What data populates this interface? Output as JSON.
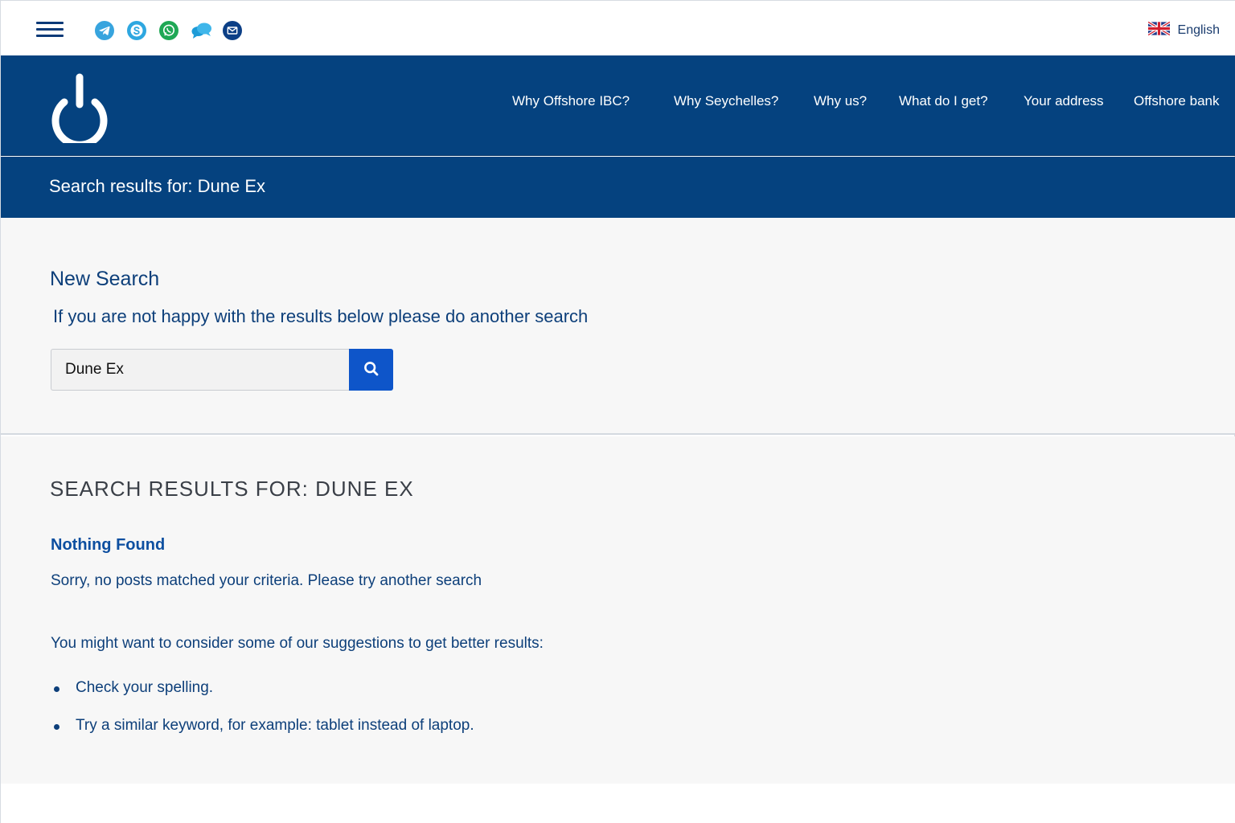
{
  "topbar": {
    "social_icons": [
      "telegram-icon",
      "skype-icon",
      "whatsapp-icon",
      "chat-icon",
      "email-icon"
    ],
    "language": {
      "label": "English",
      "flag": "uk-flag-icon"
    }
  },
  "nav": {
    "items": [
      {
        "label": "Why Offshore IBC?"
      },
      {
        "label": "Why Seychelles?"
      },
      {
        "label": "Why us?"
      },
      {
        "label": "What do I get?"
      },
      {
        "label": "Your address"
      },
      {
        "label": "Offshore bank"
      }
    ]
  },
  "title_band": {
    "text": "Search results for: Dune Ex"
  },
  "new_search": {
    "heading": "New Search",
    "subtitle": "If you are not happy with the results below please do another search",
    "input_value": "Dune Ex"
  },
  "results": {
    "heading": "SEARCH RESULTS FOR: DUNE EX",
    "nothing_found": "Nothing Found",
    "sorry": "Sorry, no posts matched your criteria. Please try another search",
    "suggest_intro": "You might want to consider some of our suggestions to get better results:",
    "suggestions": [
      "Check your spelling.",
      "Try a similar keyword, for example: tablet instead of laptop."
    ]
  },
  "colors": {
    "brand_blue": "#05427f",
    "button_blue": "#0e55c9",
    "text_blue": "#0d3f7a",
    "link_blue": "#0d4fa0"
  }
}
